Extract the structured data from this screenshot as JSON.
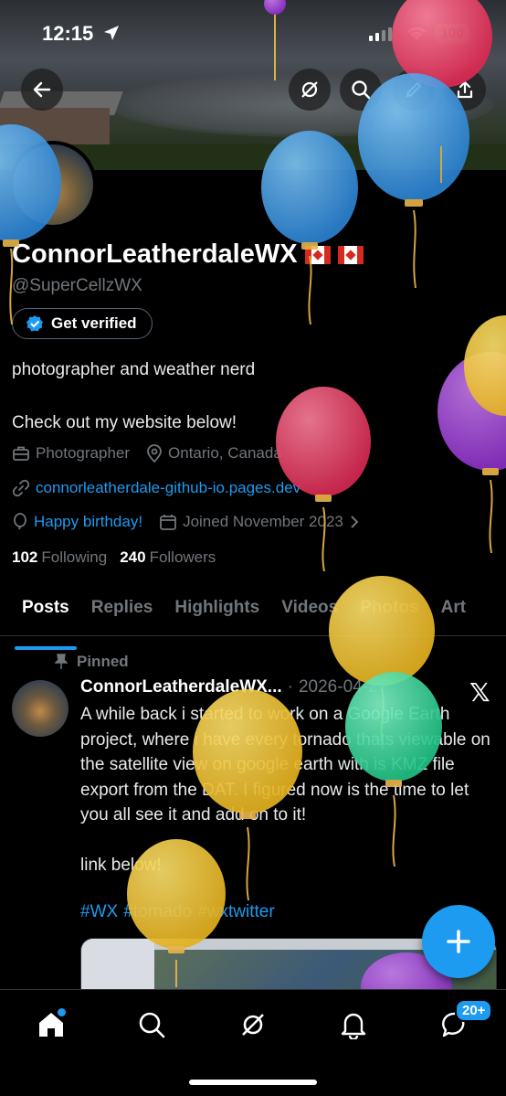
{
  "status_bar": {
    "time": "12:15",
    "battery": "100"
  },
  "top_buttons": [
    "back-arrow-icon",
    "grok-icon",
    "search-icon",
    "edit-icon",
    "share-icon"
  ],
  "profile": {
    "name": "ConnorLeatherdaleWX",
    "flags": "🇨🇦 🇨🇦",
    "handle": "@SuperCellzWX",
    "verify_label": "Get verified",
    "bio_line1": "photographer and weather nerd",
    "bio_line2": "Check out my website below!",
    "category": "Photographer",
    "location": "Ontario, Canada",
    "website": "connorleatherdale-github-io.pages.dev",
    "birthday": "Happy birthday!",
    "joined": "Joined November 2023",
    "following_count": "102",
    "following_label": "Following",
    "followers_count": "240",
    "followers_label": "Followers"
  },
  "tabs": [
    "Posts",
    "Replies",
    "Highlights",
    "Videos",
    "Photos",
    "Art"
  ],
  "pinned_post": {
    "pinned_label": "Pinned",
    "author": "ConnorLeatherdaleWX...",
    "separator": "·",
    "date": "2026-04-27",
    "text": "A while back i started to work on a Google Earth project,  where i have every tornado thats viewable on the satellite view on google earth with is KMZ file export from the DAT. I figured now is the time to let you all see it and add on to it!\n\nlink below!",
    "hashtags": [
      "#WX",
      "#tornado",
      "#wxtwitter"
    ]
  },
  "fab_label": "+",
  "bottom_nav": {
    "items": [
      "home-icon",
      "search-icon",
      "grok-icon",
      "notifications-bell-icon",
      "messages-icon"
    ],
    "messages_badge": "20+"
  },
  "colors": {
    "accent": "#1d9bf0",
    "secondary_text": "#71767b",
    "battery": "#30d158",
    "balloon_blue": "#3a9be5",
    "balloon_red": "#e23a5e",
    "balloon_yellow": "#f2c22e",
    "balloon_purple": "#9b3fd1",
    "balloon_green": "#3cd49b"
  }
}
